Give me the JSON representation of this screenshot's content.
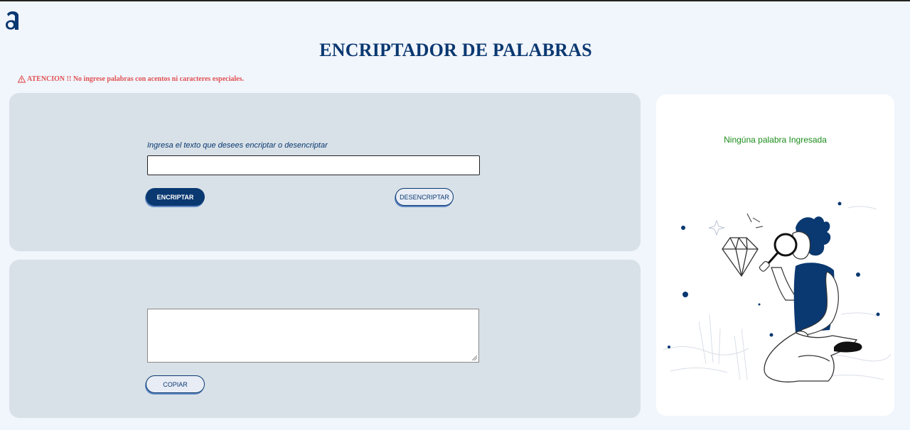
{
  "header": {
    "logo_icon": "alura-logo-icon",
    "title": "ENCRIPTADOR DE PALABRAS",
    "warning_icon": "warning-triangle-icon",
    "warning_text": "ATENCION !! No ingrese palabras con acentos ni caracteres especiales."
  },
  "input_panel": {
    "label": "Ingresa el texto que desees encriptar o desencriptar",
    "input_value": "",
    "encrypt_label": "ENCRIPTAR",
    "decrypt_label": "DESENCRIPTAR"
  },
  "output_panel": {
    "output_value": "",
    "copy_label": "COPIAR"
  },
  "side": {
    "message": "Ningúna palabra Ingresada",
    "illustration_icon": "person-magnifying-glass-diamond-illustration"
  },
  "colors": {
    "primary": "#0a3871",
    "warning": "#e05252",
    "success": "#1a8c1a",
    "panel": "#d8e1e7"
  }
}
